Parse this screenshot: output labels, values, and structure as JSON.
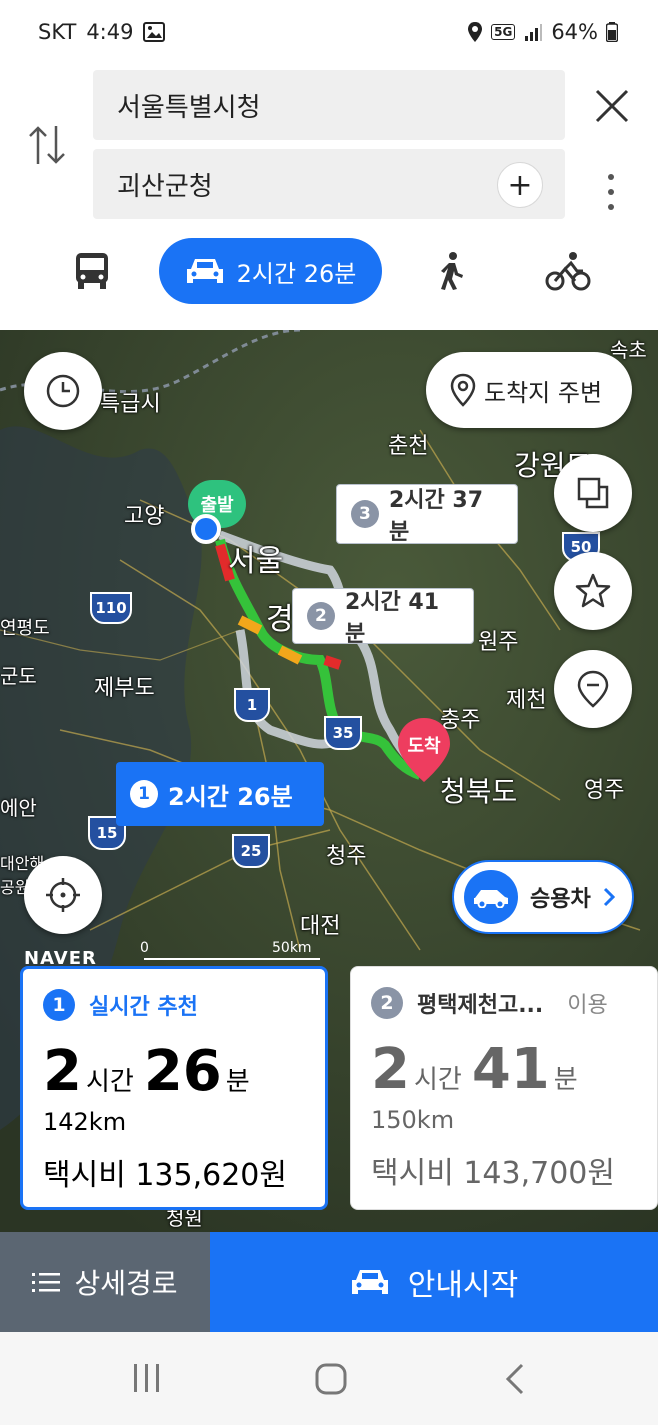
{
  "status_bar": {
    "carrier": "SKT",
    "time": "4:49",
    "network": "5G",
    "battery": "64%"
  },
  "search": {
    "origin": "서울특별시청",
    "destination": "괴산군청"
  },
  "modes": {
    "car_duration": "2시간 26분"
  },
  "map": {
    "arrival_area_label": "도착지 주변",
    "start_marker": "출발",
    "end_marker": "도착",
    "labels": [
      "특급시",
      "춘천",
      "강원도",
      "고양",
      "서울",
      "경",
      "원주",
      "제천",
      "충주",
      "제부도",
      "청북도",
      "영주",
      "청주",
      "대전",
      "속초",
      "연평도",
      "군도",
      "에안",
      "대안해",
      "공원",
      "청원"
    ],
    "scale": {
      "zero": "0",
      "distance": "50km"
    },
    "brand": "NAVER",
    "highway_numbers": [
      "110",
      "1",
      "35",
      "50",
      "15",
      "25"
    ],
    "vehicle_type": "승용차"
  },
  "route_bubbles": [
    {
      "num": "1",
      "time": "2시간 26분"
    },
    {
      "num": "2",
      "time": "2시간 41분"
    },
    {
      "num": "3",
      "time": "2시간 37분"
    }
  ],
  "cards": [
    {
      "num": "1",
      "title": "실시간 추천",
      "hours": "2",
      "hour_unit": "시간",
      "minutes": "26",
      "minute_unit": "분",
      "distance": "142km",
      "fare": "택시비 135,620원",
      "accent": "#1a73f5"
    },
    {
      "num": "2",
      "title": "평택제천고...",
      "suffix": "이용",
      "hours": "2",
      "hour_unit": "시간",
      "minutes": "41",
      "minute_unit": "분",
      "distance": "150km",
      "fare": "택시비 143,700원",
      "accent": "#8a94a6"
    }
  ],
  "bottom": {
    "detail_label": "상세경로",
    "start_label": "안내시작"
  },
  "colors": {
    "primary": "#1a73f5",
    "traffic_green": "#35c23a",
    "traffic_red": "#e22b2b",
    "traffic_orange": "#f2a71b",
    "dark_button": "#5b6672"
  }
}
